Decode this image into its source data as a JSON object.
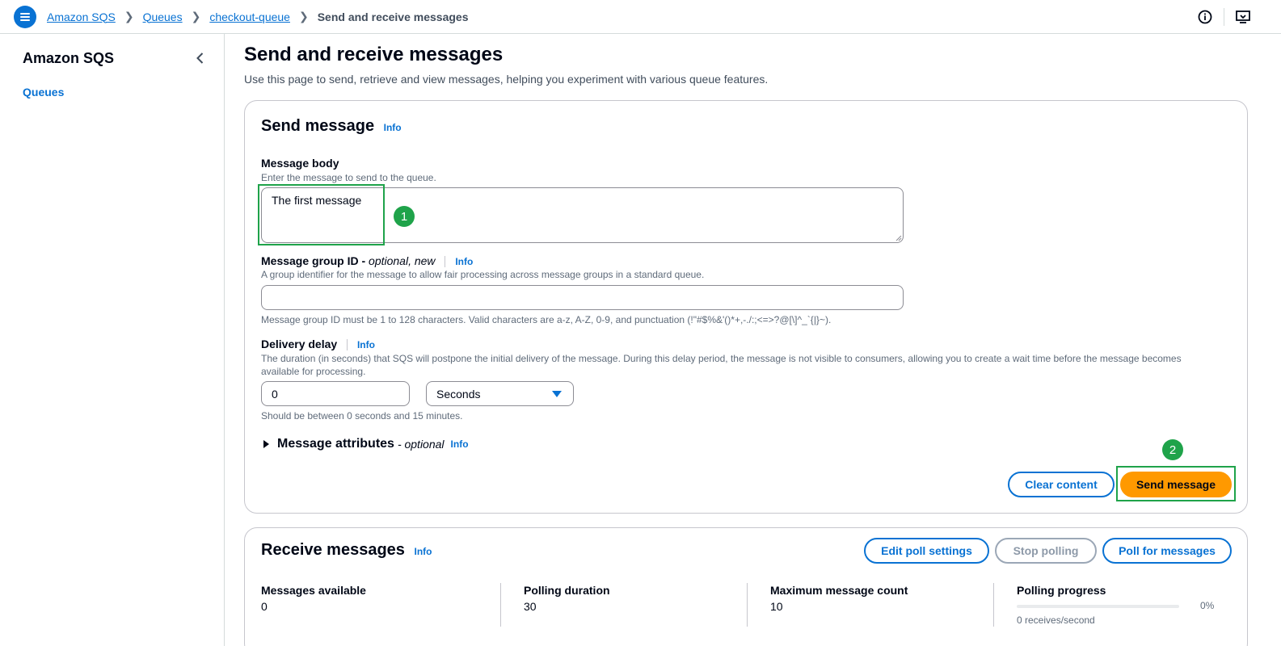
{
  "breadcrumb": {
    "items": [
      "Amazon SQS",
      "Queues",
      "checkout-queue"
    ],
    "current": "Send and receive messages"
  },
  "sidenav": {
    "title": "Amazon SQS",
    "links": [
      "Queues"
    ]
  },
  "page": {
    "title": "Send and receive messages",
    "description": "Use this page to send, retrieve and view messages, helping you experiment with various queue features."
  },
  "send": {
    "title": "Send message",
    "info": "Info",
    "body_label": "Message body",
    "body_desc": "Enter the message to send to the queue.",
    "body_value": "The first message",
    "group_label": "Message group ID -",
    "group_optional": "optional, new",
    "group_info": "Info",
    "group_desc": "A group identifier for the message to allow fair processing across message groups in a standard queue.",
    "group_value": "",
    "group_constraint": "Message group ID must be 1 to 128 characters. Valid characters are a-z, A-Z, 0-9, and punctuation (!\"#$%&'()*+,-./:;<=>?@[\\]^_`{|}~).",
    "delay_label": "Delivery delay",
    "delay_info": "Info",
    "delay_desc": "The duration (in seconds) that SQS will postpone the initial delivery of the message. During this delay period, the message is not visible to consumers, allowing you to create a wait time before the message becomes available for processing.",
    "delay_value": "0",
    "delay_unit": "Seconds",
    "delay_constraint": "Should be between 0 seconds and 15 minutes.",
    "attributes_label": "Message attributes",
    "attributes_optional": "- optional",
    "attributes_info": "Info",
    "clear_button": "Clear content",
    "send_button": "Send message"
  },
  "receive": {
    "title": "Receive messages",
    "info": "Info",
    "edit_button": "Edit poll settings",
    "stop_button": "Stop polling",
    "poll_button": "Poll for messages",
    "stats": {
      "available_label": "Messages available",
      "available_value": "0",
      "duration_label": "Polling duration",
      "duration_value": "30",
      "max_label": "Maximum message count",
      "max_value": "10",
      "progress_label": "Polling progress",
      "progress_percent": "0%",
      "progress_fraction": 0,
      "rate": "0 receives/second"
    }
  },
  "annotations": [
    "1",
    "2"
  ],
  "colors": {
    "accent": "#0972d3",
    "primary_button": "#ff9900",
    "annotation": "#1fa34a"
  }
}
